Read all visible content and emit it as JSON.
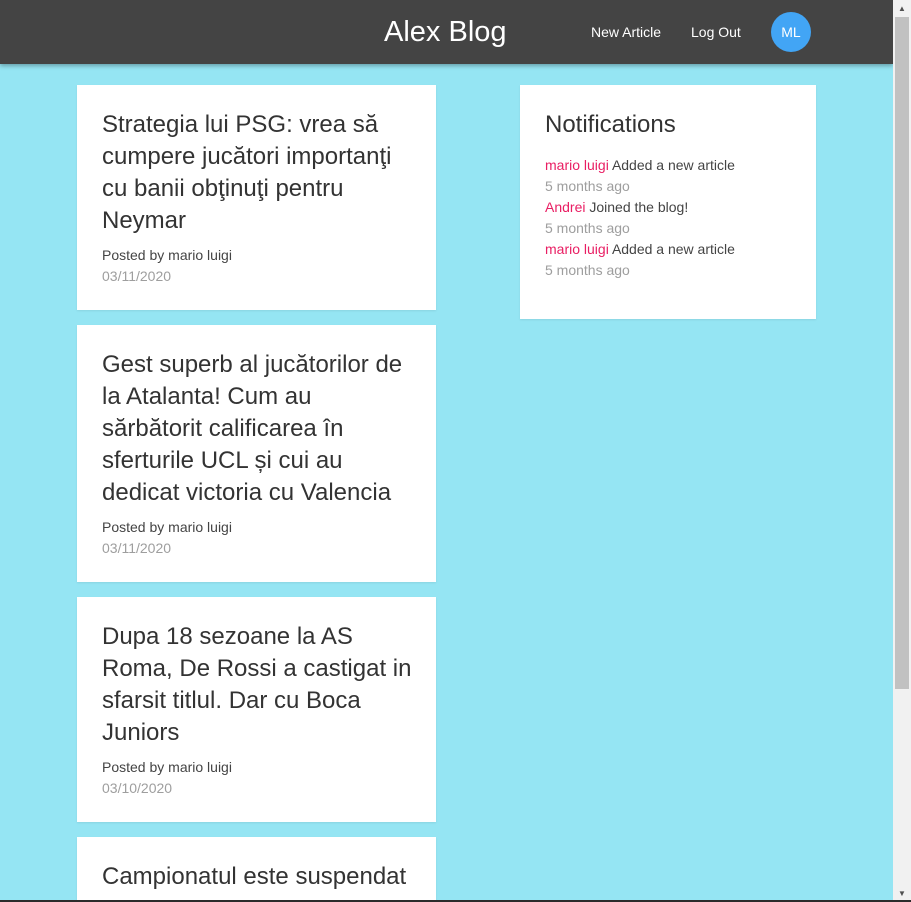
{
  "navbar": {
    "brand": "Alex Blog",
    "links": [
      "New Article",
      "Log Out"
    ],
    "avatar_initials": "ML"
  },
  "articles": [
    {
      "title": "Strategia lui PSG: vrea să cumpere jucători importanţi cu banii obţinuţi pentru Neymar",
      "posted_by": "Posted by mario luigi",
      "date": "03/11/2020"
    },
    {
      "title": "Gest superb al jucătorilor de la Atalanta! Cum au sărbătorit calificarea în sferturile UCL și cui au dedicat victoria cu Valencia",
      "posted_by": "Posted by mario luigi",
      "date": "03/11/2020"
    },
    {
      "title": "Dupa 18 sezoane la AS Roma, De Rossi a castigat in sfarsit titlul. Dar cu Boca Juniors",
      "posted_by": "Posted by mario luigi",
      "date": "03/10/2020"
    },
    {
      "title": "Campionatul este suspendat",
      "posted_by": "",
      "date": ""
    }
  ],
  "notifications": {
    "title": "Notifications",
    "items": [
      {
        "user": "mario luigi",
        "action": "Added a new article",
        "time": "5 months ago"
      },
      {
        "user": "Andrei",
        "action": "Joined the blog!",
        "time": "5 months ago"
      },
      {
        "user": "mario luigi",
        "action": "Added a new article",
        "time": "5 months ago"
      }
    ]
  },
  "colors": {
    "background": "#95e5f3",
    "navbar": "#444444",
    "avatar": "#42a5f5",
    "notif_user": "#e91e63",
    "muted": "#9e9e9e"
  }
}
